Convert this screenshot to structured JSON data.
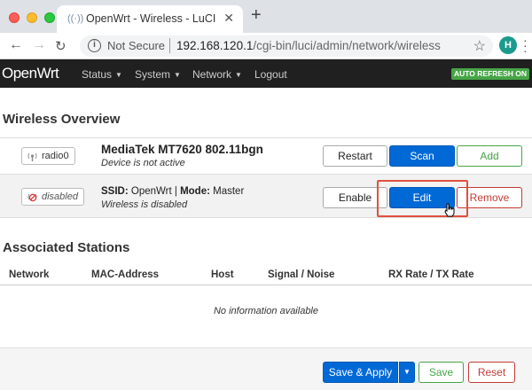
{
  "browser": {
    "tab_title": "OpenWrt - Wireless - LuCI",
    "tab_close": "✕",
    "new_tab": "+",
    "security_label": "Not Secure",
    "url_host": "192.168.120.1",
    "url_path": "/cgi-bin/luci/admin/network/wireless",
    "profile_initial": "H"
  },
  "header": {
    "brand": "OpenWrt",
    "menu": [
      {
        "label": "Status"
      },
      {
        "label": "System"
      },
      {
        "label": "Network"
      },
      {
        "label": "Logout"
      }
    ],
    "auto_refresh": "AUTO REFRESH ON"
  },
  "wireless": {
    "title": "Wireless Overview",
    "radio": {
      "badge": "radio0",
      "name": "MediaTek MT7620 802.11bgn",
      "status": "Device is not active",
      "buttons": {
        "restart": "Restart",
        "scan": "Scan",
        "add": "Add"
      }
    },
    "network": {
      "badge": "disabled",
      "ssid_label": "SSID:",
      "ssid": "OpenWrt",
      "mode_label": "Mode:",
      "mode": "Master",
      "status": "Wireless is disabled",
      "buttons": {
        "enable": "Enable",
        "edit": "Edit",
        "remove": "Remove"
      }
    }
  },
  "stations": {
    "title": "Associated Stations",
    "columns": [
      "Network",
      "MAC-Address",
      "Host",
      "Signal / Noise",
      "RX Rate / TX Rate"
    ],
    "empty": "No information available"
  },
  "footer": {
    "save_apply": "Save & Apply",
    "save": "Save",
    "reset": "Reset"
  },
  "colors": {
    "primary": "#0069d6",
    "success": "#46a546",
    "danger": "#c43c35",
    "highlight": "#e0503e"
  }
}
